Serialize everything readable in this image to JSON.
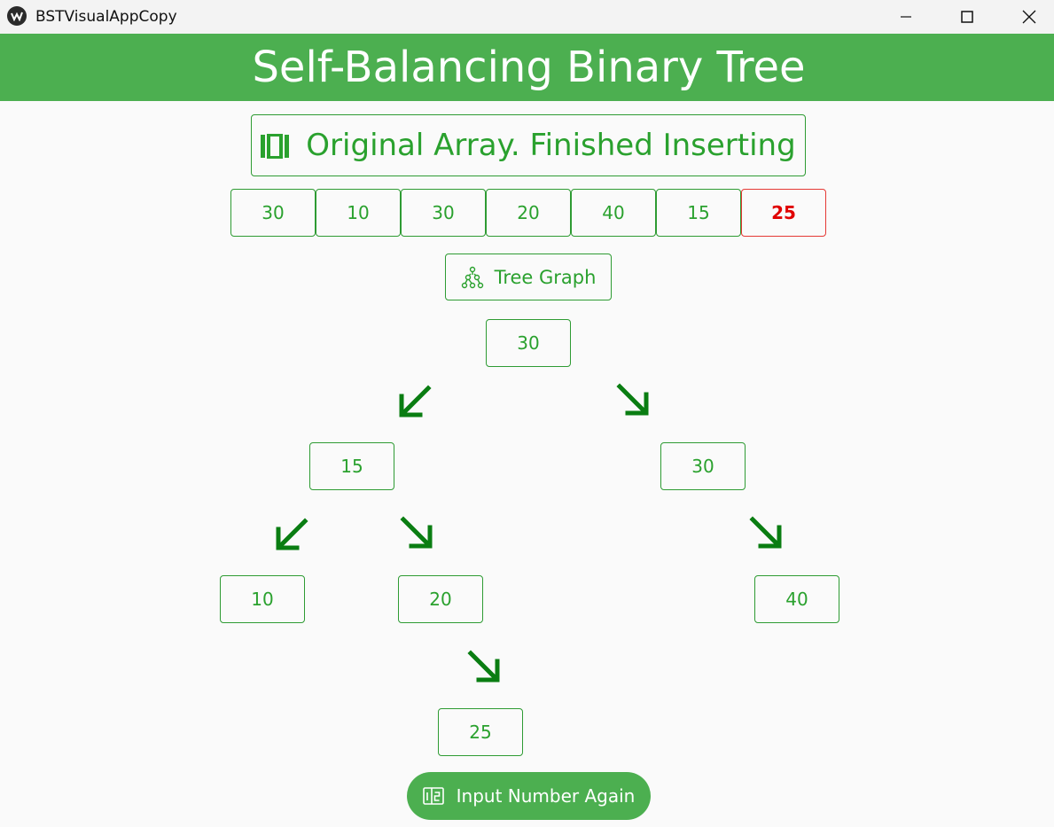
{
  "window": {
    "title": "BSTVisualAppCopy"
  },
  "header": {
    "title": "Self-Balancing Binary Tree"
  },
  "status": {
    "icon": "array-icon",
    "text": "Original Array. Finished Inserting"
  },
  "array": {
    "values": [
      "30",
      "10",
      "30",
      "20",
      "40",
      "15",
      "25"
    ],
    "highlighted_index": 6
  },
  "graph_chip": {
    "icon": "tree-graph-icon",
    "label": "Tree Graph"
  },
  "tree": {
    "root": "30",
    "root_left": "15",
    "root_right": "30",
    "left_left": "10",
    "left_right": "20",
    "right_right": "40",
    "left_right_right": "25"
  },
  "actions": {
    "input_again_icon": "number-input-icon",
    "input_again_label": "Input Number Again"
  },
  "colors": {
    "primary": "#4caf50",
    "text_green": "#2aa12e",
    "arrow_green": "#0a7d12",
    "highlight": "#e00000"
  }
}
